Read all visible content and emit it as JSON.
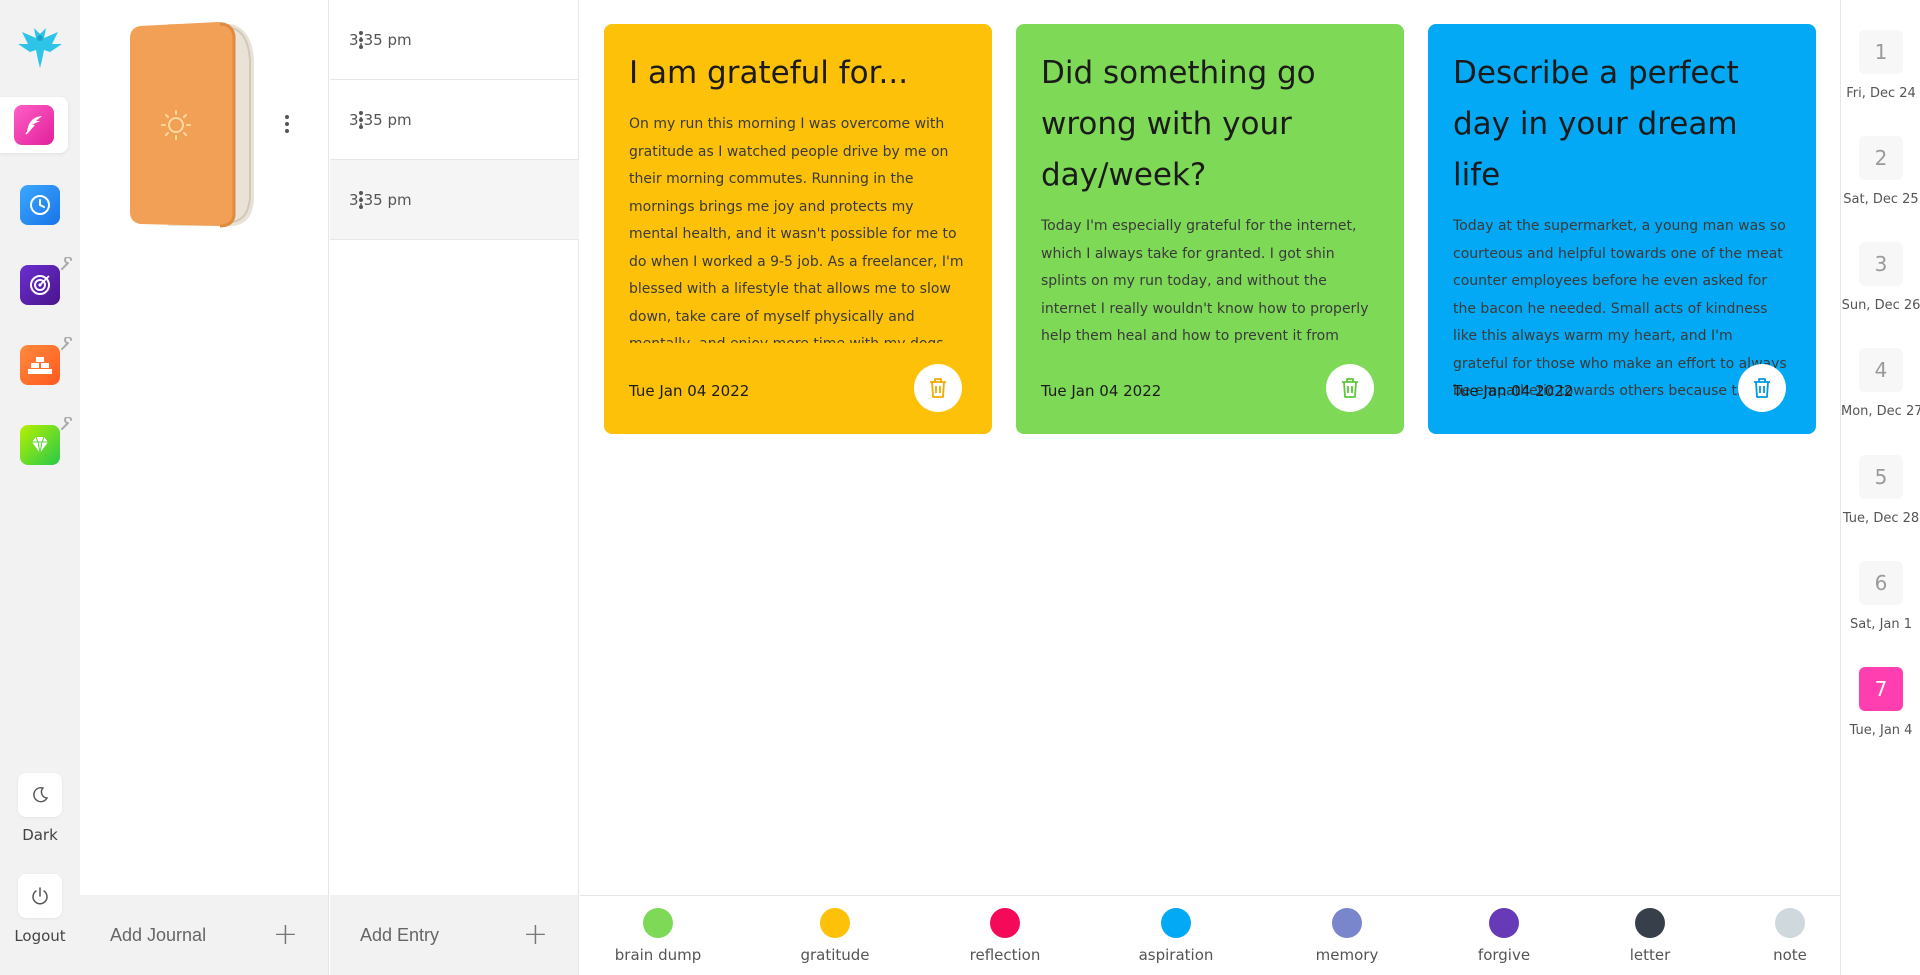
{
  "sidebar": {
    "dark_label": "Dark",
    "logout_label": "Logout"
  },
  "journals": {
    "add_label": "Add Journal"
  },
  "entries": {
    "items": [
      {
        "time": "3:35 pm"
      },
      {
        "time": "3:35 pm"
      },
      {
        "time": "3:35 pm"
      }
    ],
    "add_label": "Add Entry"
  },
  "cards": [
    {
      "title": "I am grateful for...",
      "body": "On my run this morning I was overcome with gratitude as I watched people drive by me on their morning commutes. Running in the mornings brings me joy and protects my mental health, and it wasn't possible for me to do when I worked a 9-5 job. As a freelancer, I'm blessed with a lifestyle that allows me to slow down, take care of myself physically and mentally, and enjoy more time with my dogs and those I care about. I'm truly so",
      "date": "Tue Jan 04 2022",
      "color": "#FDC10A",
      "icon_color": "#F2A900"
    },
    {
      "title": "Did something go wrong with your day/week?",
      "body": "Today I'm especially grateful for the internet, which I always take for granted. I got shin splints on my run today, and without the internet I really wouldn't know how to properly help them heal and how to prevent it from happening again. The internet is indispensable for me when it comes to",
      "date": "Tue Jan 04 2022",
      "color": "#7ED957",
      "icon_color": "#5CC83A"
    },
    {
      "title": "Describe a perfect day in your dream life",
      "body": "Today at the supermarket, a young man was so courteous and helpful towards one of the meat counter employees before he even asked for the bacon he needed. Small acts of kindness like this always warm my heart, and I'm grateful for those who make an effort to always be empathetic towards others because those are the people who make the world such a good place.",
      "date": "Tue Jan 04 2022",
      "color": "#03A9F4",
      "icon_color": "#0297E0"
    }
  ],
  "tags": [
    {
      "name": "brain dump",
      "color": "#7ED957"
    },
    {
      "name": "gratitude",
      "color": "#FDC10A"
    },
    {
      "name": "reflection",
      "color": "#F50A5A"
    },
    {
      "name": "aspiration",
      "color": "#03A9F4"
    },
    {
      "name": "memory",
      "color": "#7986CB"
    },
    {
      "name": "forgive",
      "color": "#673AB7"
    },
    {
      "name": "letter",
      "color": "#37404A"
    },
    {
      "name": "note",
      "color": "#CFD8DC"
    }
  ],
  "dates": [
    {
      "num": "1",
      "label": "Fri, Dec 24"
    },
    {
      "num": "2",
      "label": "Sat, Dec 25"
    },
    {
      "num": "3",
      "label": "Sun, Dec 26"
    },
    {
      "num": "4",
      "label": "Mon, Dec 27"
    },
    {
      "num": "5",
      "label": "Tue, Dec 28"
    },
    {
      "num": "6",
      "label": "Sat, Jan 1"
    },
    {
      "num": "7",
      "label": "Tue, Jan 4"
    }
  ]
}
